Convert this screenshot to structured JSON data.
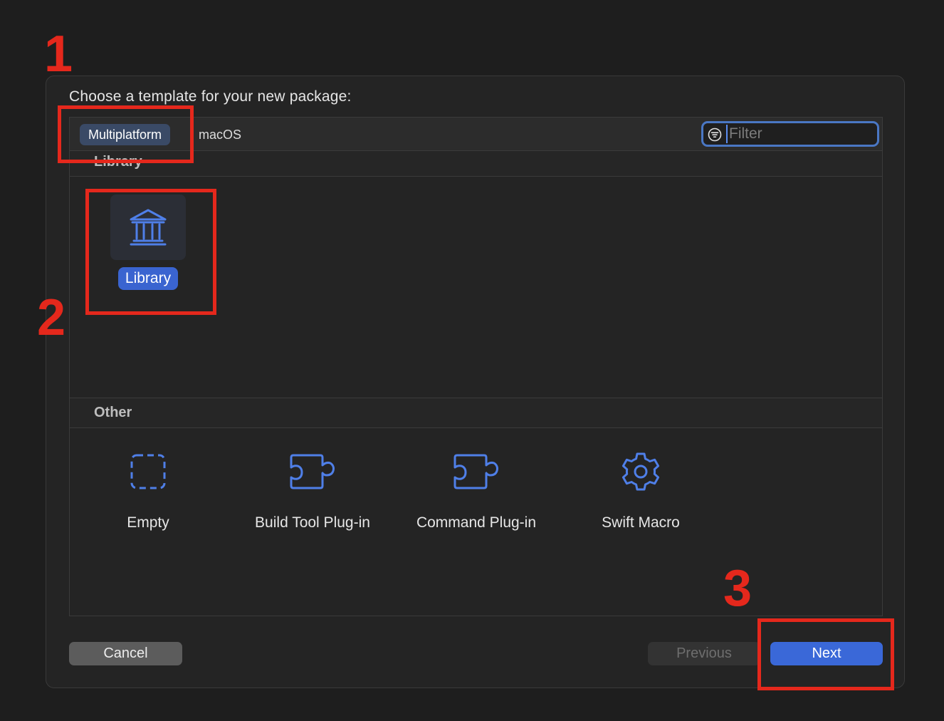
{
  "dialog": {
    "title": "Choose a template for your new package:"
  },
  "tabs": [
    {
      "label": "Multiplatform",
      "selected": true
    },
    {
      "label": "macOS",
      "selected": false
    }
  ],
  "filter": {
    "placeholder": "Filter",
    "value": "",
    "icon": "filter-circle-icon"
  },
  "sections": {
    "library": {
      "title": "Library",
      "templates": [
        {
          "label": "Library",
          "icon": "building-columns-icon",
          "selected": true
        }
      ]
    },
    "other": {
      "title": "Other",
      "templates": [
        {
          "label": "Empty",
          "icon": "dashed-square-icon"
        },
        {
          "label": "Build Tool Plug-in",
          "icon": "puzzle-piece-icon"
        },
        {
          "label": "Command Plug-in",
          "icon": "puzzle-piece-icon"
        },
        {
          "label": "Swift Macro",
          "icon": "gear-icon"
        }
      ]
    }
  },
  "buttons": {
    "cancel": "Cancel",
    "previous": "Previous",
    "next": "Next"
  },
  "annotations": [
    "1",
    "2",
    "3"
  ],
  "colors": {
    "accent": "#3a68d8",
    "icon_blue": "#4f7fe8",
    "annotation_red": "#e5281c"
  }
}
